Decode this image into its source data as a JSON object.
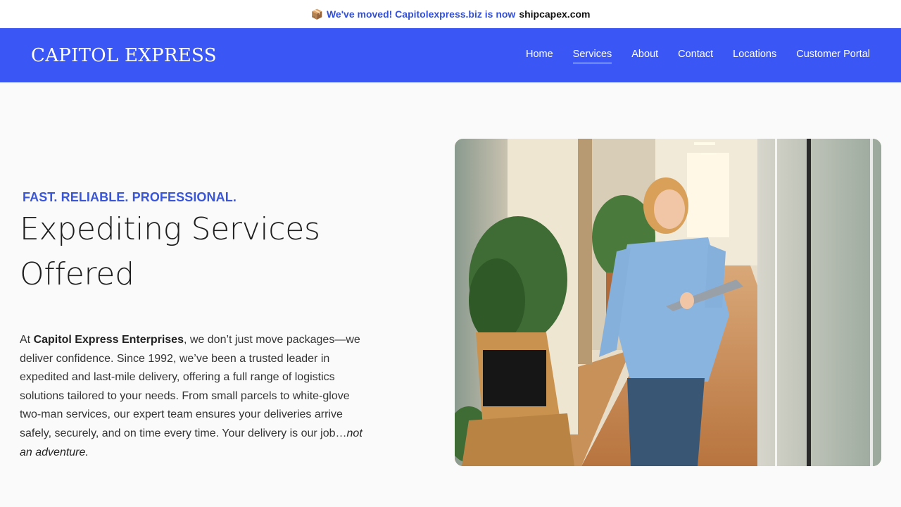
{
  "announcement": {
    "icon": "package-icon",
    "moved_text": "We've moved! Capitolexpress.biz is now",
    "new_domain": "shipcapex.com"
  },
  "header": {
    "logo": "CAPITOL EXPRESS",
    "nav": [
      {
        "label": "Home",
        "active": false
      },
      {
        "label": "Services",
        "active": true
      },
      {
        "label": "About",
        "active": false
      },
      {
        "label": "Contact",
        "active": false
      },
      {
        "label": "Locations",
        "active": false
      },
      {
        "label": "Customer Portal",
        "active": false
      }
    ]
  },
  "hero": {
    "tagline": "FAST. RELIABLE. PROFESSIONAL.",
    "headline_line1": "Expediting Services",
    "headline_line2": "Offered",
    "desc_prefix": "At ",
    "desc_company": "Capitol Express Enterprises",
    "desc_body": ", we don’t just move packages—we deliver confidence. Since 1992, we’ve been a trusted leader in expedited and last-mile delivery, offering a full range of logistics solutions tailored to your needs. From small parcels to white-glove two-man services, our expert team ensures your deliveries arrive safely, securely, and on time every time. Your delivery is our job…",
    "desc_italic": "not an adventure."
  },
  "colors": {
    "brand_blue": "#3a56f5",
    "tagline_blue": "#3a56d8",
    "announce_blue": "#3350d8"
  }
}
